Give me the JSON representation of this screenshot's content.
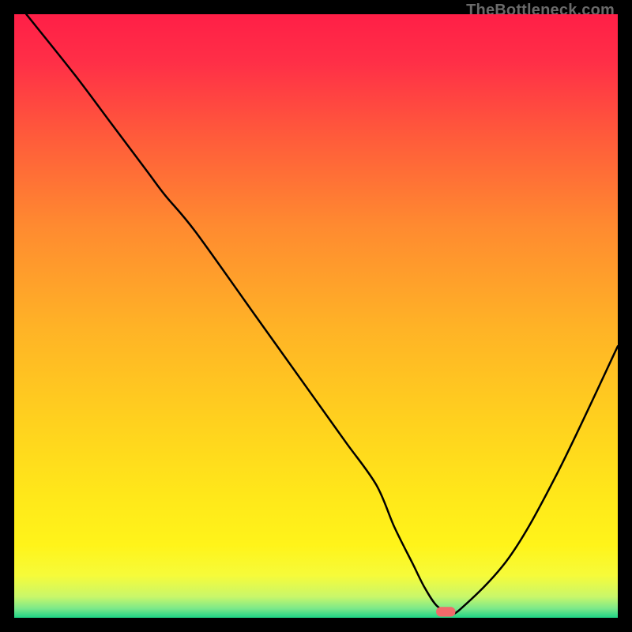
{
  "watermark": "TheBottleneck.com",
  "chart_data": {
    "type": "line",
    "title": "",
    "xlabel": "",
    "ylabel": "",
    "xlim": [
      0,
      100
    ],
    "ylim": [
      0,
      100
    ],
    "series": [
      {
        "name": "curve",
        "x": [
          2,
          10,
          16,
          22,
          25,
          30,
          40,
          50,
          55,
          60,
          63,
          66,
          68,
          70,
          72,
          74,
          82,
          90,
          100
        ],
        "values": [
          100,
          90,
          82,
          74,
          70,
          64,
          50,
          36,
          29,
          22,
          15,
          9,
          5,
          2,
          1,
          1.5,
          10,
          24,
          45
        ]
      }
    ],
    "marker": {
      "x": 71.5,
      "y": 1,
      "w": 3.2,
      "h": 1.6,
      "color": "#f06a6a"
    },
    "gradient_stops": [
      {
        "offset": 0.0,
        "color": "#ff1f47"
      },
      {
        "offset": 0.08,
        "color": "#ff2f47"
      },
      {
        "offset": 0.2,
        "color": "#ff5a3b"
      },
      {
        "offset": 0.35,
        "color": "#ff8a30"
      },
      {
        "offset": 0.52,
        "color": "#ffb326"
      },
      {
        "offset": 0.68,
        "color": "#ffd21e"
      },
      {
        "offset": 0.8,
        "color": "#ffe81a"
      },
      {
        "offset": 0.88,
        "color": "#fff41a"
      },
      {
        "offset": 0.93,
        "color": "#f6fb3a"
      },
      {
        "offset": 0.965,
        "color": "#c9f76a"
      },
      {
        "offset": 0.985,
        "color": "#7ae88a"
      },
      {
        "offset": 1.0,
        "color": "#1ed486"
      }
    ]
  }
}
